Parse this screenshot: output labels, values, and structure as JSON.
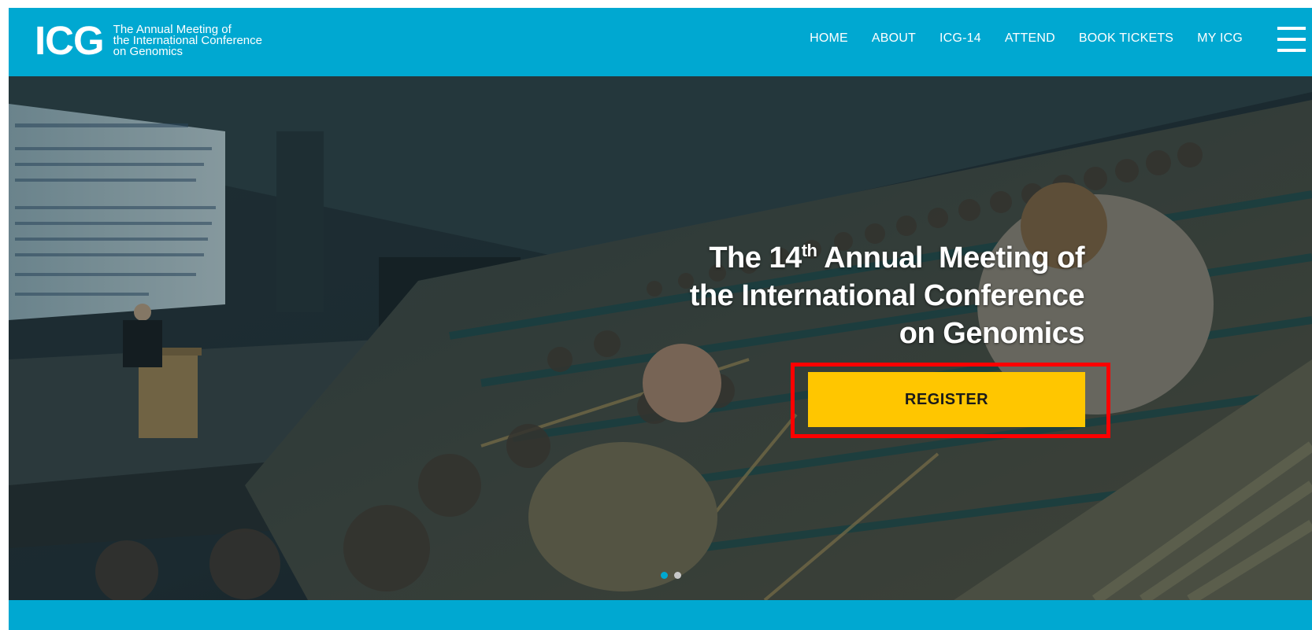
{
  "logo": {
    "mark": "ICG",
    "lines": [
      "The Annual Meeting of",
      "the International Conference",
      "on Genomics"
    ]
  },
  "nav": {
    "items": [
      {
        "label": "HOME"
      },
      {
        "label": "ABOUT"
      },
      {
        "label": "ICG-14"
      },
      {
        "label": "ATTEND"
      },
      {
        "label": "BOOK TICKETS"
      },
      {
        "label": "MY ICG"
      }
    ],
    "menu_icon": "hamburger-menu-icon"
  },
  "hero": {
    "title_line1_pre": "The 14",
    "title_line1_sup": "th",
    "title_line1_post": " Annual  Meeting of",
    "title_line2": "the International Conference",
    "title_line3": "on Genomics",
    "register_label": "REGISTER",
    "slides_total": 2,
    "active_slide": 1
  },
  "colors": {
    "brand": "#00a8d1",
    "button": "#ffc600",
    "highlight": "#ff0000"
  }
}
